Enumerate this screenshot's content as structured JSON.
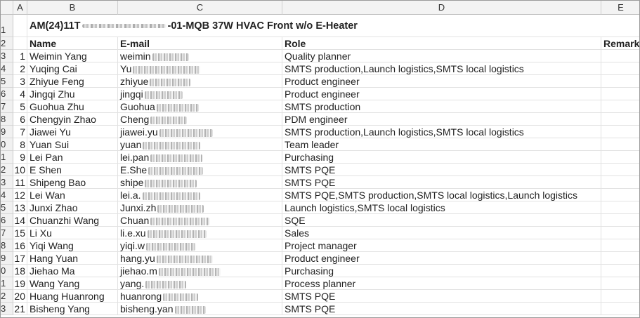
{
  "columns": [
    "A",
    "B",
    "C",
    "D",
    "E"
  ],
  "title_row": {
    "row_label": "1",
    "prefix": "AM(24)11T",
    "suffix": "-01-MQB 37W HVAC Front w/o E-Heater"
  },
  "header_row": {
    "row_label": "2",
    "name": "Name",
    "email": "E-mail",
    "role": "Role",
    "remark": "Remark"
  },
  "rows": [
    {
      "row_label": "3",
      "no": "1",
      "name": "Weimin Yang",
      "email": "weimin",
      "role": "Quality planner"
    },
    {
      "row_label": "4",
      "no": "2",
      "name": "Yuqing Cai",
      "email": "Yu",
      "role": "SMTS production,Launch logistics,SMTS local logistics"
    },
    {
      "row_label": "5",
      "no": "3",
      "name": "Zhiyue Feng",
      "email": "zhiyue",
      "role": "Product engineer"
    },
    {
      "row_label": "6",
      "no": "4",
      "name": "Jingqi Zhu",
      "email": "jingqi",
      "role": "Product engineer"
    },
    {
      "row_label": "7",
      "no": "5",
      "name": "Guohua Zhu",
      "email": "Guohua",
      "role": "SMTS production"
    },
    {
      "row_label": "8",
      "no": "6",
      "name": "Chengyin Zhao",
      "email": "Cheng",
      "role": "PDM engineer"
    },
    {
      "row_label": "9",
      "no": "7",
      "name": "Jiawei Yu",
      "email": "jiawei.yu",
      "role": "SMTS production,Launch logistics,SMTS local logistics"
    },
    {
      "row_label": "0",
      "no": "8",
      "name": "Yuan Sui",
      "email": "yuan",
      "role": "Team leader"
    },
    {
      "row_label": "1",
      "no": "9",
      "name": "Lei Pan",
      "email": "lei.pan",
      "role": "Purchasing"
    },
    {
      "row_label": "2",
      "no": "10",
      "name": "E Shen",
      "email": "E.She",
      "role": "SMTS PQE"
    },
    {
      "row_label": "3",
      "no": "11",
      "name": "Shipeng Bao",
      "email": "shipe",
      "role": "SMTS PQE"
    },
    {
      "row_label": "4",
      "no": "12",
      "name": "Lei Wan",
      "email": "lei.a.",
      "role": "SMTS PQE,SMTS production,SMTS local logistics,Launch logistics"
    },
    {
      "row_label": "5",
      "no": "13",
      "name": "Junxi Zhao",
      "email": "Junxi.zh",
      "role": "Launch logistics,SMTS local logistics"
    },
    {
      "row_label": "6",
      "no": "14",
      "name": "Chuanzhi Wang",
      "email": "Chuan",
      "role": "SQE"
    },
    {
      "row_label": "7",
      "no": "15",
      "name": "Li Xu",
      "email": "li.e.xu",
      "role": "Sales"
    },
    {
      "row_label": "8",
      "no": "16",
      "name": "Yiqi Wang",
      "email": "yiqi.w",
      "role": "Project manager"
    },
    {
      "row_label": "9",
      "no": "17",
      "name": "Hang Yuan",
      "email": "hang.yu",
      "role": "Product engineer"
    },
    {
      "row_label": "0",
      "no": "18",
      "name": "Jiehao Ma",
      "email": "jiehao.m",
      "role": "Purchasing"
    },
    {
      "row_label": "1",
      "no": "19",
      "name": "Wang Yang",
      "email": "yang.",
      "role": "Process planner"
    },
    {
      "row_label": "2",
      "no": "20",
      "name": "Huang Huanrong",
      "email": "huanrong",
      "role": "SMTS PQE"
    },
    {
      "row_label": "3",
      "no": "21",
      "name": "Bisheng Yang",
      "email": "bisheng.yan",
      "role": "SMTS PQE"
    }
  ]
}
